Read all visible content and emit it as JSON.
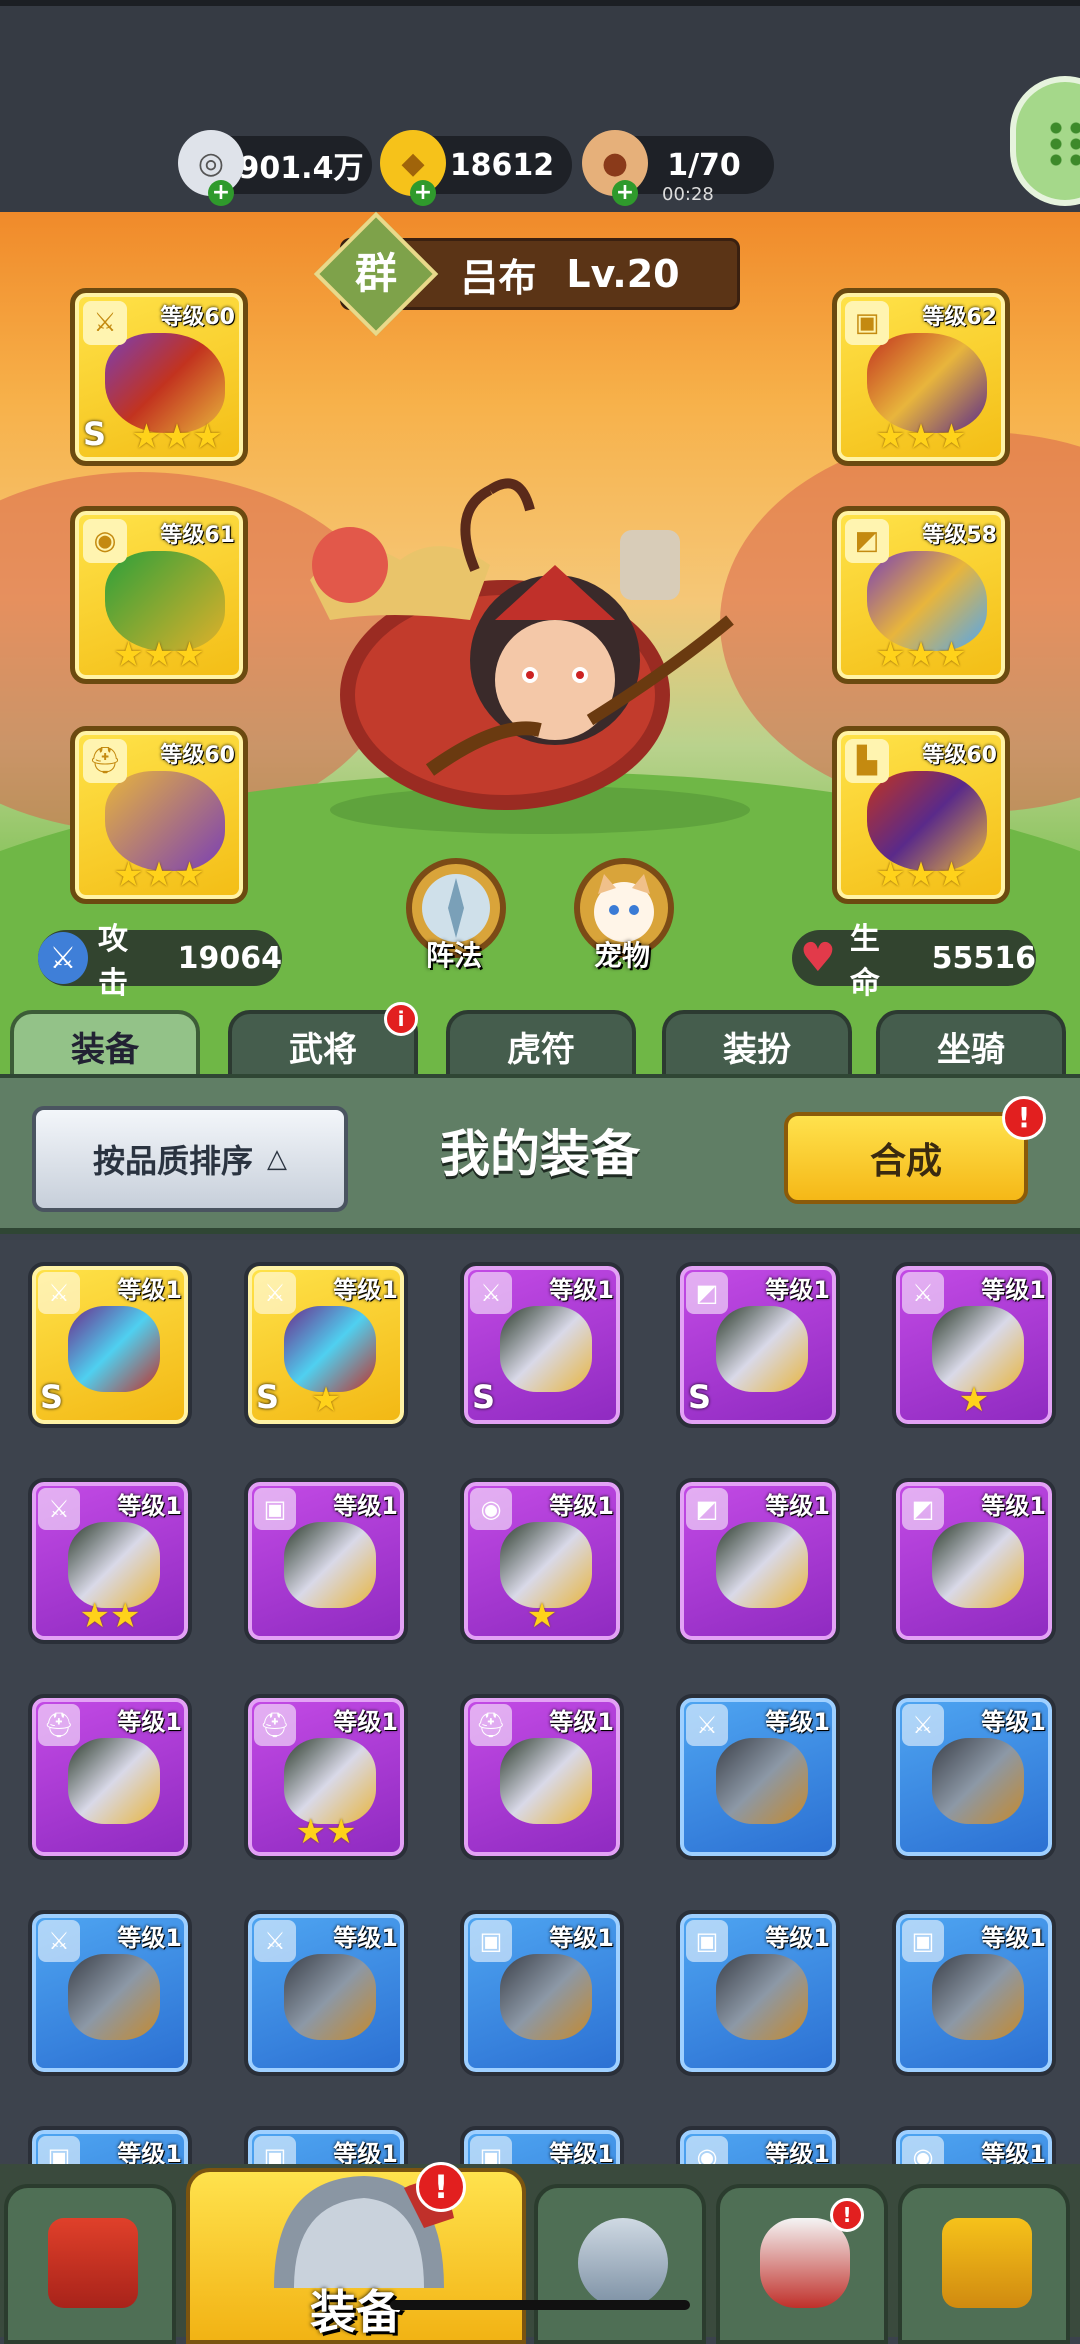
{
  "resources": [
    {
      "icon": "silver-coin-icon",
      "value": "901.4万"
    },
    {
      "icon": "gold-ingot-icon",
      "value": "18612"
    },
    {
      "icon": "meat-stamina-icon",
      "value": "1/70",
      "timer": "00:28"
    }
  ],
  "hero": {
    "faction": "群",
    "name": "吕布",
    "level": "Lv.20"
  },
  "equipped": {
    "left": [
      {
        "icon": "sword-slot-icon",
        "level": "等级60",
        "grade": "S",
        "stars": 3
      },
      {
        "icon": "medal-slot-icon",
        "level": "等级61",
        "grade": "",
        "stars": 3
      },
      {
        "icon": "helmet-slot-icon",
        "level": "等级60",
        "grade": "",
        "stars": 3
      }
    ],
    "right": [
      {
        "icon": "armor-slot-icon",
        "level": "等级62",
        "grade": "",
        "stars": 3
      },
      {
        "icon": "bracer-slot-icon",
        "level": "等级58",
        "grade": "",
        "stars": 3
      },
      {
        "icon": "boot-slot-icon",
        "level": "等级60",
        "grade": "",
        "stars": 3
      }
    ]
  },
  "buttons": {
    "formation": "阵法",
    "pet": "宠物"
  },
  "stats": {
    "attack_label": "攻击",
    "attack": "19064",
    "hp_label": "生命",
    "hp": "55516"
  },
  "tabs": [
    {
      "label": "装备",
      "active": true,
      "badge": false
    },
    {
      "label": "武将",
      "active": false,
      "badge": true,
      "badge_text": "i"
    },
    {
      "label": "虎符",
      "active": false,
      "badge": false
    },
    {
      "label": "装扮",
      "active": false,
      "badge": false
    },
    {
      "label": "坐骑",
      "active": false,
      "badge": false
    }
  ],
  "panel": {
    "sort_label": "按品质排序",
    "title": "我的装备",
    "merge_label": "合成",
    "merge_badge": "!"
  },
  "inventory": [
    {
      "rarity": "gold",
      "icon": "sword-slot-icon",
      "level": "等级1",
      "grade": "S",
      "stars": 0
    },
    {
      "rarity": "gold",
      "icon": "sword-slot-icon",
      "level": "等级1",
      "grade": "S",
      "stars": 1
    },
    {
      "rarity": "purple",
      "icon": "sword-slot-icon",
      "level": "等级1",
      "grade": "S",
      "stars": 0
    },
    {
      "rarity": "purple",
      "icon": "bracer-slot-icon",
      "level": "等级1",
      "grade": "S",
      "stars": 0
    },
    {
      "rarity": "purple",
      "icon": "sword-slot-icon",
      "level": "等级1",
      "grade": "",
      "stars": 1
    },
    {
      "rarity": "purple",
      "icon": "sword-slot-icon",
      "level": "等级1",
      "grade": "",
      "stars": 2
    },
    {
      "rarity": "purple",
      "icon": "armor-slot-icon",
      "level": "等级1",
      "grade": "",
      "stars": 0
    },
    {
      "rarity": "purple",
      "icon": "medal-slot-icon",
      "level": "等级1",
      "grade": "",
      "stars": 1
    },
    {
      "rarity": "purple",
      "icon": "bracer-slot-icon",
      "level": "等级1",
      "grade": "",
      "stars": 0
    },
    {
      "rarity": "purple",
      "icon": "bracer-slot-icon",
      "level": "等级1",
      "grade": "",
      "stars": 0
    },
    {
      "rarity": "purple",
      "icon": "helmet-slot-icon",
      "level": "等级1",
      "grade": "",
      "stars": 0
    },
    {
      "rarity": "purple",
      "icon": "helmet-slot-icon",
      "level": "等级1",
      "grade": "",
      "stars": 2
    },
    {
      "rarity": "purple",
      "icon": "helmet-slot-icon",
      "level": "等级1",
      "grade": "",
      "stars": 0
    },
    {
      "rarity": "blue",
      "icon": "sword-slot-icon",
      "level": "等级1",
      "grade": "",
      "stars": 0
    },
    {
      "rarity": "blue",
      "icon": "sword-slot-icon",
      "level": "等级1",
      "grade": "",
      "stars": 0
    },
    {
      "rarity": "blue",
      "icon": "sword-slot-icon",
      "level": "等级1",
      "grade": "",
      "stars": 0
    },
    {
      "rarity": "blue",
      "icon": "sword-slot-icon",
      "level": "等级1",
      "grade": "",
      "stars": 0
    },
    {
      "rarity": "blue",
      "icon": "armor-slot-icon",
      "level": "等级1",
      "grade": "",
      "stars": 0
    },
    {
      "rarity": "blue",
      "icon": "armor-slot-icon",
      "level": "等级1",
      "grade": "",
      "stars": 0
    },
    {
      "rarity": "blue",
      "icon": "armor-slot-icon",
      "level": "等级1",
      "grade": "",
      "stars": 0
    },
    {
      "rarity": "blue",
      "icon": "armor-slot-icon",
      "level": "等级1",
      "grade": "",
      "stars": 0
    },
    {
      "rarity": "blue",
      "icon": "armor-slot-icon",
      "level": "等级1",
      "grade": "",
      "stars": 0
    },
    {
      "rarity": "blue",
      "icon": "armor-slot-icon",
      "level": "等级1",
      "grade": "",
      "stars": 0
    },
    {
      "rarity": "blue",
      "icon": "medal-slot-icon",
      "level": "等级1",
      "grade": "",
      "stars": 0
    },
    {
      "rarity": "blue",
      "icon": "medal-slot-icon",
      "level": "等级1",
      "grade": "",
      "stars": 0
    }
  ],
  "bottom_nav": [
    {
      "icon": "city-gate-icon",
      "label": "",
      "active": false,
      "badge": false
    },
    {
      "icon": "helmet-icon",
      "label": "装备",
      "active": true,
      "badge": true,
      "badge_text": "!"
    },
    {
      "icon": "crossed-swords-icon",
      "label": "",
      "active": false,
      "badge": false
    },
    {
      "icon": "war-horn-icon",
      "label": "",
      "active": false,
      "badge": true,
      "badge_text": "!"
    },
    {
      "icon": "upgrade-fist-icon",
      "label": "",
      "active": false,
      "badge": false
    }
  ],
  "colors": {
    "gold": "#f5c21a",
    "purple": "#a13ad3",
    "blue": "#3b87e0",
    "panel": "#607e65",
    "badge": "#e21f1f"
  }
}
